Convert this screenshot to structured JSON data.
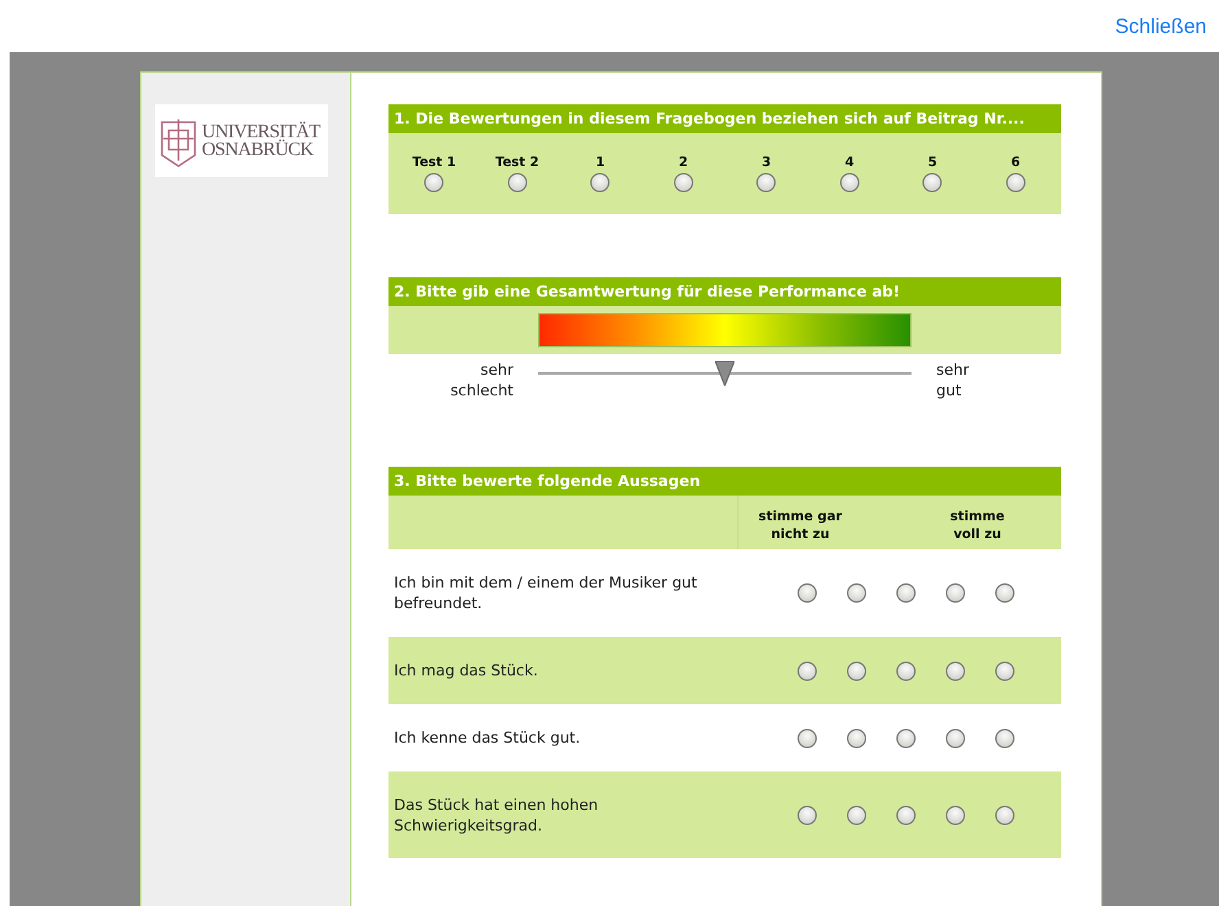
{
  "top_bar": {
    "close_link": "Schließen"
  },
  "logo": {
    "line_1": "UNIVERSITÄT",
    "line_2": "OSNABRÜCK"
  },
  "question_1": {
    "title": "1. Die Bewertungen in diesem Fragebogen beziehen sich auf Beitrag Nr....",
    "options": [
      {
        "label": "Test 1",
        "selected": false
      },
      {
        "label": "Test 2",
        "selected": false
      },
      {
        "label": "1",
        "selected": false
      },
      {
        "label": "2",
        "selected": false
      },
      {
        "label": "3",
        "selected": false
      },
      {
        "label": "4",
        "selected": false
      },
      {
        "label": "5",
        "selected": false
      },
      {
        "label": "6",
        "selected": false
      }
    ]
  },
  "question_2": {
    "title": "2. Bitte gib eine Gesamtwertung für diese Performance ab!",
    "left_label": "sehr schlecht",
    "right_label": "sehr gut",
    "slider": {
      "level": 0.5
    }
  },
  "question_3": {
    "title": "3. Bitte bewerte folgende Aussagen",
    "scale_low": "stimme gar nicht zu",
    "scale_high": "stimme voll zu",
    "statements": [
      {
        "text": "Ich bin mit dem / einem der Musiker gut befreundet.",
        "options": [
          {
            "selected": false
          },
          {
            "selected": false
          },
          {
            "selected": false
          },
          {
            "selected": false
          },
          {
            "selected": false
          }
        ]
      },
      {
        "text": "Ich mag das Stück.",
        "options": [
          {
            "selected": false
          },
          {
            "selected": false
          },
          {
            "selected": false
          },
          {
            "selected": false
          },
          {
            "selected": false
          }
        ]
      },
      {
        "text": "Ich kenne das Stück gut.",
        "options": [
          {
            "selected": false
          },
          {
            "selected": false
          },
          {
            "selected": false
          },
          {
            "selected": false
          },
          {
            "selected": false
          }
        ]
      },
      {
        "text": "Das Stück hat einen hohen Schwierigkeitsgrad.",
        "options": [
          {
            "selected": false
          },
          {
            "selected": false
          },
          {
            "selected": false
          },
          {
            "selected": false
          },
          {
            "selected": false
          }
        ]
      }
    ]
  }
}
